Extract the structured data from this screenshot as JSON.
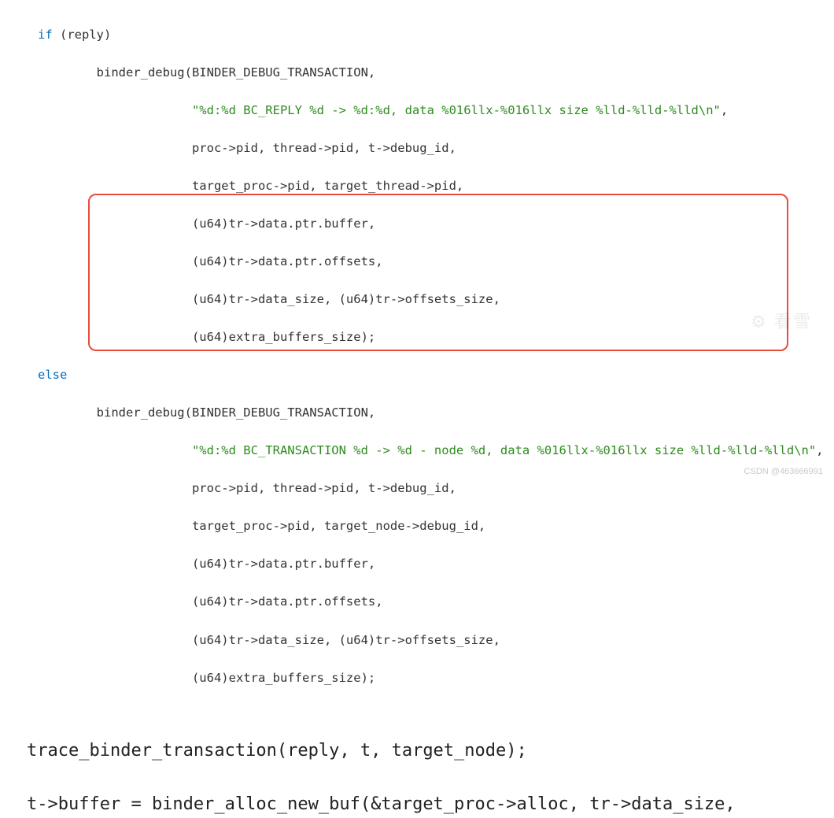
{
  "code": {
    "l01a": "if",
    "l01b": " (reply)",
    "l02": "        binder_debug(BINDER_DEBUG_TRANSACTION,",
    "l03_pre": "                     ",
    "l03_str": "\"%d:%d BC_REPLY %d -> %d:%d, data %016llx-%016llx size %lld-%lld-%lld\\n\"",
    "l03_post": ",",
    "l04": "                     proc->pid, thread->pid, t->debug_id,",
    "l05": "                     target_proc->pid, target_thread->pid,",
    "l06": "                     (u64)tr->data.ptr.buffer,",
    "l07": "                     (u64)tr->data.ptr.offsets,",
    "l08": "                     (u64)tr->data_size, (u64)tr->offsets_size,",
    "l09": "                     (u64)extra_buffers_size);",
    "l10": "else",
    "l11": "        binder_debug(BINDER_DEBUG_TRANSACTION,",
    "l12_pre": "                     ",
    "l12_str": "\"%d:%d BC_TRANSACTION %d -> %d - node %d, data %016llx-%016llx size %lld-%lld-%lld\\n\"",
    "l12_post": ",",
    "l13": "                     proc->pid, thread->pid, t->debug_id,",
    "l14": "                     target_proc->pid, target_node->debug_id,",
    "l15": "                     (u64)tr->data.ptr.buffer,",
    "l16": "                     (u64)tr->data.ptr.offsets,",
    "l17": "                     (u64)tr->data_size, (u64)tr->offsets_size,",
    "l18": "                     (u64)extra_buffers_size);"
  },
  "big": {
    "line1": "trace_binder_transaction(reply, t, target_node);",
    "line2": "t->buffer = binder_alloc_new_buf(&target_proc->alloc, tr->data_size,"
  },
  "watermarks": {
    "w1": "⚙ 看雪",
    "w2": "CSDN @463666991"
  }
}
